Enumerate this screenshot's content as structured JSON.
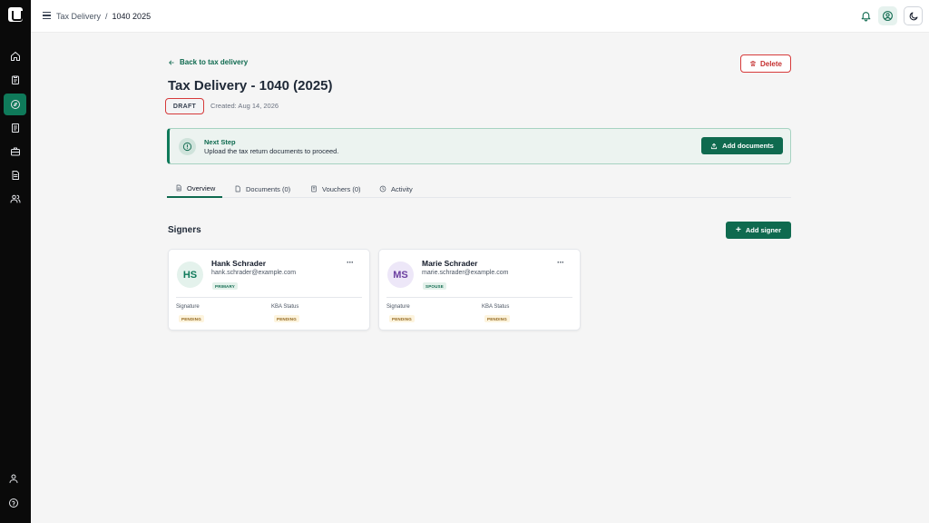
{
  "breadcrumb": {
    "parent": "Tax Delivery",
    "separator": "/",
    "current": "1040 2025"
  },
  "sidebar": {
    "items": [
      {
        "icon": "home-icon"
      },
      {
        "icon": "clipboard-icon"
      },
      {
        "icon": "compass-icon",
        "active": true
      },
      {
        "icon": "receipt-icon"
      },
      {
        "icon": "briefcase-icon"
      },
      {
        "icon": "document-icon"
      },
      {
        "icon": "users-icon"
      }
    ],
    "bottom": [
      {
        "icon": "user-icon"
      },
      {
        "icon": "help-icon"
      }
    ]
  },
  "header": {
    "back_label": "Back to tax delivery",
    "title": "Tax Delivery - 1040 (2025)",
    "status": "DRAFT",
    "created": "Created: Aug 14, 2026",
    "delete_label": "Delete"
  },
  "next_step": {
    "title": "Next Step",
    "message": "Upload the tax return documents to proceed.",
    "action_label": "Add documents"
  },
  "tabs": [
    {
      "label": "Overview",
      "icon": "file-icon",
      "active": true
    },
    {
      "label": "Documents (0)",
      "icon": "document-icon"
    },
    {
      "label": "Vouchers (0)",
      "icon": "receipt-icon"
    },
    {
      "label": "Activity",
      "icon": "clock-icon"
    }
  ],
  "signers": {
    "heading": "Signers",
    "add_label": "Add signer",
    "list": [
      {
        "initials": "HS",
        "name": "Hank Schrader",
        "email": "hank.schrader@example.com",
        "role": "PRIMARY",
        "signature_label": "Signature",
        "signature_status": "PENDING",
        "kba_label": "KBA Status",
        "kba_status": "PENDING",
        "avatar_bg": "#e4f2ec",
        "avatar_color": "#0f7a5a"
      },
      {
        "initials": "MS",
        "name": "Marie Schrader",
        "email": "marie.schrader@example.com",
        "role": "SPOUSE",
        "signature_label": "Signature",
        "signature_status": "PENDING",
        "kba_label": "KBA Status",
        "kba_status": "PENDING",
        "avatar_bg": "#ede7f8",
        "avatar_color": "#6b3fa0"
      }
    ]
  },
  "colors": {
    "brand": "#0f6a4f",
    "danger": "#d63a3a"
  }
}
